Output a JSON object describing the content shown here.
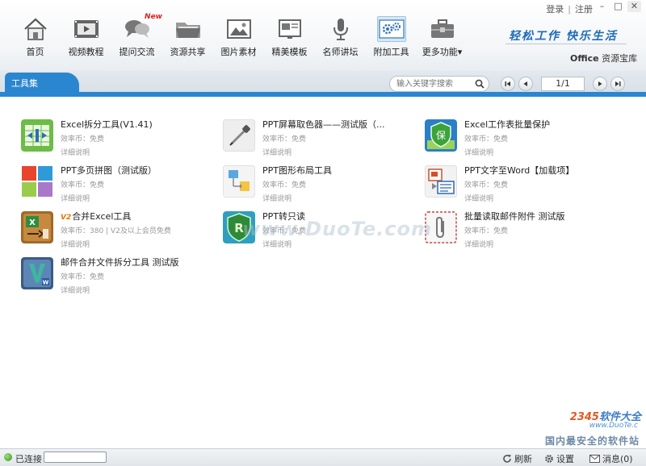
{
  "window": {
    "links": [
      "登录",
      "注册"
    ],
    "controls": [
      "–",
      "□",
      "✕"
    ]
  },
  "nav": [
    {
      "label": "首页",
      "icon": "house-icon"
    },
    {
      "label": "视频教程",
      "icon": "film-icon"
    },
    {
      "label": "提问交流",
      "icon": "chat-bubbles-icon",
      "badge": "New"
    },
    {
      "label": "资源共享",
      "icon": "folder-share-icon"
    },
    {
      "label": "图片素材",
      "icon": "picture-icon"
    },
    {
      "label": "精美模板",
      "icon": "template-icon"
    },
    {
      "label": "名师讲坛",
      "icon": "microphone-icon"
    },
    {
      "label": "附加工具",
      "icon": "gears-icon"
    },
    {
      "label": "更多功能",
      "icon": "toolbox-icon",
      "dropdown": "▾"
    }
  ],
  "branding": {
    "slogan": "轻松工作 快乐生活",
    "product_bold": "Office",
    "product_rest": " 资源宝库"
  },
  "tabs": {
    "active": "工具集"
  },
  "search": {
    "placeholder": "输入关键字搜索"
  },
  "pager": {
    "current": "1/1"
  },
  "tools": [
    {
      "title": "Excel拆分工具(V1.41)",
      "price": "效率币：免费",
      "detail": "详细说明",
      "icon": "excel-split-icon"
    },
    {
      "title": "PPT屏幕取色器——测试版（...",
      "price": "效率币：免费",
      "detail": "详细说明",
      "icon": "eyedropper-icon"
    },
    {
      "title": "Excel工作表批量保护",
      "price": "效率币：免费",
      "detail": "详细说明",
      "icon": "shield-protect-icon"
    },
    {
      "title": "PPT多页拼图（测试版）",
      "price": "效率币：免费",
      "detail": "详细说明",
      "icon": "tiles-icon"
    },
    {
      "title": "PPT图形布局工具",
      "price": "效率币：免费",
      "detail": "详细说明",
      "icon": "layout-icon"
    },
    {
      "title": "PPT文字至Word【加载项】",
      "price": "效率币：免费",
      "detail": "详细说明",
      "icon": "ppt-to-word-icon"
    },
    {
      "title": "合并Excel工具",
      "prefix": "V2",
      "price": "效率币：380 | V2及以上会员免费",
      "detail": "详细说明",
      "icon": "excel-merge-icon"
    },
    {
      "title": "PPT转只读",
      "price": "效率币：免费",
      "detail": "详细说明",
      "icon": "readonly-shield-icon"
    },
    {
      "title": "批量读取邮件附件 测试版",
      "price": "效率币：免费",
      "detail": "详细说明",
      "icon": "paperclip-icon"
    },
    {
      "title": "邮件合并文件拆分工具 测试版",
      "price": "效率币：免费",
      "detail": "详细说明",
      "icon": "mail-merge-icon"
    }
  ],
  "watermarks": {
    "center": "www.DuoTe.com",
    "corner_brand_a": "2345",
    "corner_brand_b": "软件大全",
    "corner_url": "www.DuoTe.c",
    "corner_tagline": "国内最安全的软件站"
  },
  "status": {
    "connection": "已连接",
    "refresh": "刷新",
    "settings": "设置",
    "messages": "消息(0)"
  }
}
